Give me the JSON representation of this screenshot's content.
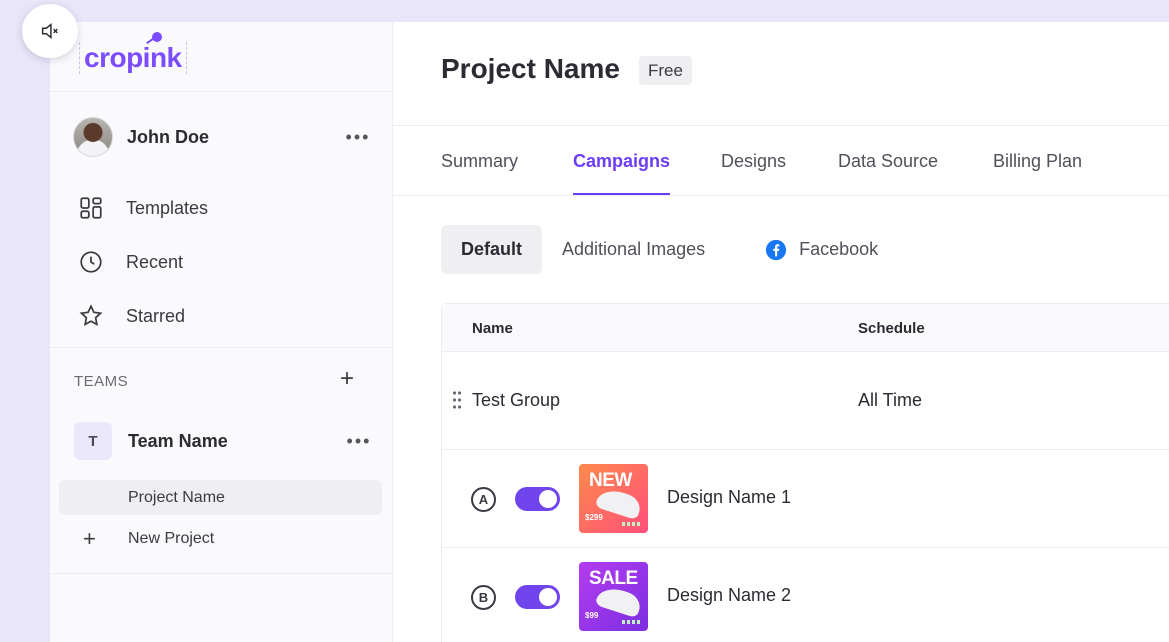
{
  "brand": {
    "logo_text": "cropink",
    "accent": "#6b3df5"
  },
  "user": {
    "name": "John Doe"
  },
  "sidebar": {
    "nav": [
      {
        "label": "Templates",
        "icon": "templates-grid-icon"
      },
      {
        "label": "Recent",
        "icon": "clock-icon"
      },
      {
        "label": "Starred",
        "icon": "star-icon"
      }
    ],
    "teams_label": "TEAMS",
    "team": {
      "badge": "T",
      "name": "Team Name"
    },
    "project_item": "Project Name",
    "new_project": "New Project"
  },
  "header": {
    "title": "Project Name",
    "plan_badge": "Free"
  },
  "tabs": [
    {
      "label": "Summary"
    },
    {
      "label": "Campaigns",
      "active": true
    },
    {
      "label": "Designs"
    },
    {
      "label": "Data Source"
    },
    {
      "label": "Billing Plan"
    }
  ],
  "subtabs": [
    {
      "label": "Default",
      "active": true
    },
    {
      "label": "Additional Images"
    },
    {
      "label": "Facebook",
      "icon": "facebook-icon"
    }
  ],
  "table": {
    "columns": [
      "Name",
      "Schedule"
    ],
    "group": {
      "name": "Test Group",
      "schedule": "All Time"
    },
    "designs": [
      {
        "letter": "A",
        "name": "Design Name 1",
        "enabled": true,
        "thumb_word": "NEW",
        "thumb_price": "$299"
      },
      {
        "letter": "B",
        "name": "Design Name 2",
        "enabled": true,
        "thumb_word": "SALE",
        "thumb_price": "$99"
      }
    ]
  }
}
